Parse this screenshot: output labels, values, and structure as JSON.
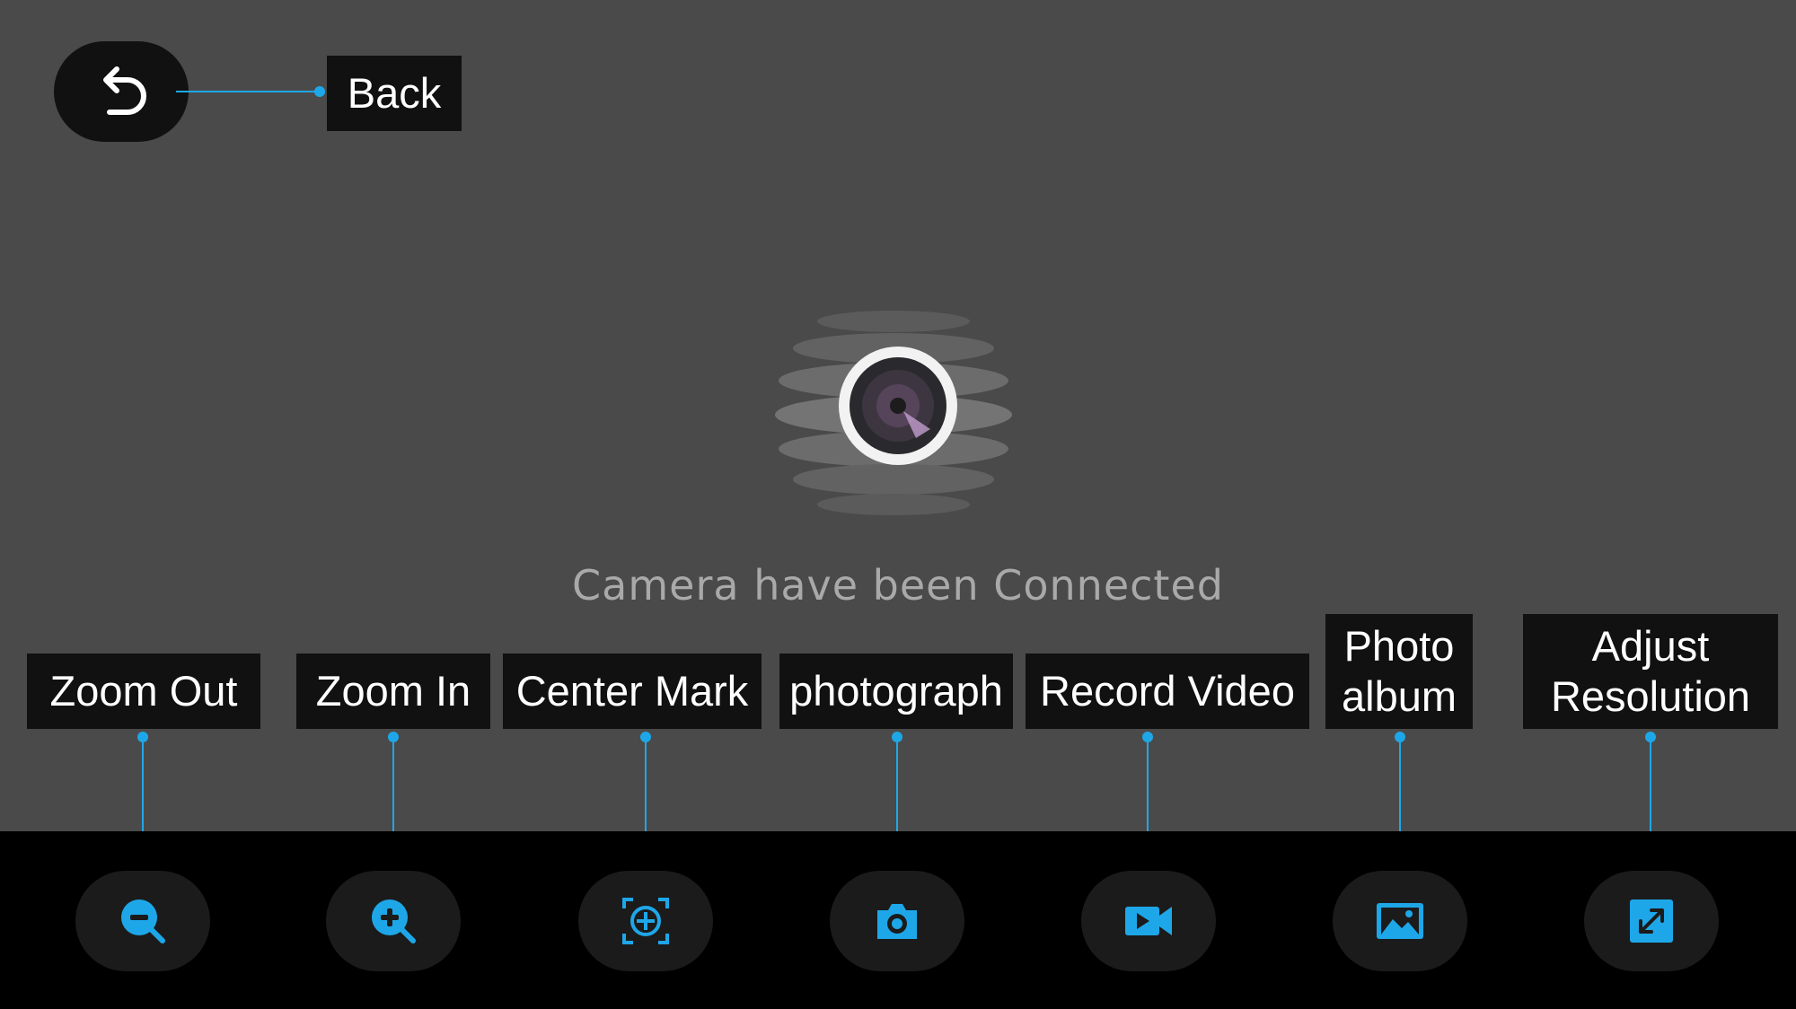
{
  "back": {
    "label": "Back",
    "icon": "back-arrow-icon"
  },
  "status": {
    "text": "Camera have been Connected"
  },
  "toolbar": {
    "accent_color": "#1ea7e8",
    "items": [
      {
        "label": "Zoom Out",
        "icon": "zoom-out-icon"
      },
      {
        "label": "Zoom In",
        "icon": "zoom-in-icon"
      },
      {
        "label": "Center Mark",
        "icon": "center-mark-icon"
      },
      {
        "label": "photograph",
        "icon": "camera-icon"
      },
      {
        "label": "Record Video",
        "icon": "video-icon"
      },
      {
        "label": "Photo\nalbum",
        "icon": "photo-album-icon"
      },
      {
        "label": "Adjust\nResolution",
        "icon": "resolution-icon"
      }
    ]
  }
}
